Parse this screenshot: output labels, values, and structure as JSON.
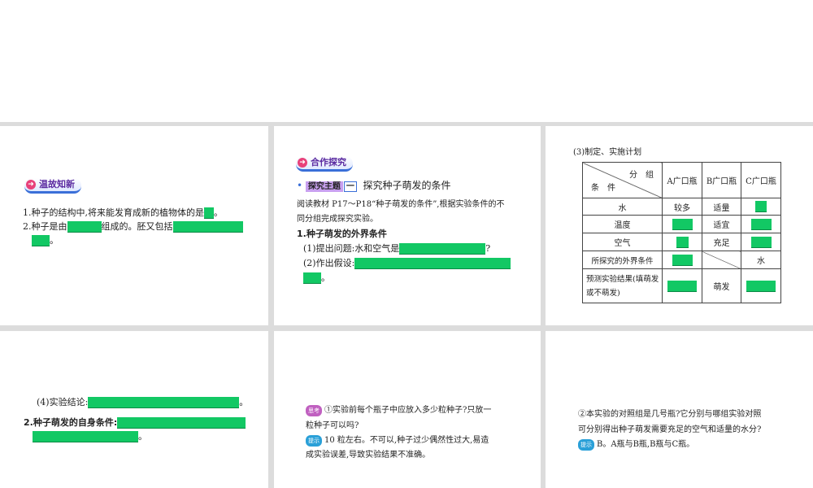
{
  "p1": {
    "badge": "温故知新",
    "q1": "1.种子的结构中,将来能发育成新的植物体的是",
    "q2a": "2.种子是由",
    "q2b": "组成的。胚又包括",
    "end": "。"
  },
  "p2": {
    "badge": "合作探究",
    "topic_tag": "探究主题",
    "topic_num": "一",
    "topic_title": "探究种子萌发的条件",
    "intro1": "阅读教材 P17～P18“种子萌发的条件”,根据实验条件的不",
    "intro2": "同分组完成探究实验。",
    "h1": "1.种子萌发的外界条件",
    "s1": "(1)提出问题:水和空气是",
    "s1end": "?",
    "s2": "(2)作出假设:",
    "end": "。"
  },
  "p3": {
    "title": "(3)制定、实施计划",
    "hdr_group": "分　组",
    "hdr_cond": "条　件",
    "cols": [
      "A广口瓶",
      "B广口瓶",
      "C广口瓶"
    ],
    "rows": [
      {
        "label": "水",
        "a": "较多",
        "b": "适量"
      },
      {
        "label": "温度",
        "b": "适宜"
      },
      {
        "label": "空气",
        "b": "充足"
      },
      {
        "label": "所探究的外界条件",
        "c": "水"
      },
      {
        "label": "预测实验结果(填萌发或不萌发)",
        "b": "萌发"
      }
    ]
  },
  "p4": {
    "s4": "(4)实验结论:",
    "h2": "2.种子萌发的自身条件:",
    "end": "。"
  },
  "p5": {
    "think_tag": "思考",
    "q1": "①实验前每个瓶子中应放入多少粒种子?只放一",
    "q2": "粒种子可以吗?",
    "hint_tag": "提示",
    "a1": "10 粒左右。不可以,种子过少偶然性过大,易造",
    "a2": "成实验误差,导致实验结果不准确。"
  },
  "p6": {
    "q1": "②本实验的对照组是几号瓶?它分别与哪组实验对照",
    "q2": "可分别得出种子萌发需要充足的空气和适量的水分?",
    "hint_tag": "提示",
    "a1": "B。A瓶与B瓶,B瓶与C瓶。"
  }
}
